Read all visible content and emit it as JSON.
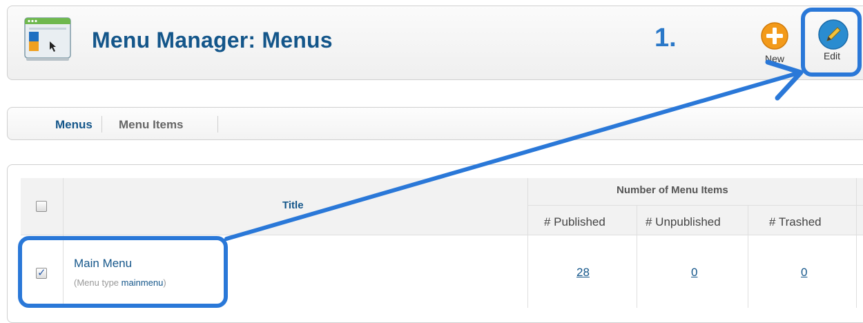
{
  "header": {
    "title": "Menu Manager: Menus",
    "step_label": "1.",
    "icon": "menu-manager-icon"
  },
  "toolbar": {
    "new_label": "New",
    "edit_label": "Edit",
    "new_icon": "plus-circle-icon",
    "edit_icon": "pencil-circle-icon"
  },
  "submenu": {
    "tabs": [
      {
        "label": "Menus",
        "active": true
      },
      {
        "label": "Menu Items",
        "active": false
      }
    ]
  },
  "table": {
    "title_header": "Title",
    "group_header": "Number of Menu Items",
    "sub_headers": [
      "# Published",
      "# Unpublished",
      "# Trashed"
    ],
    "rows": [
      {
        "title": "Main Menu",
        "menu_type_prefix": "(Menu type ",
        "menu_type": "mainmenu",
        "menu_type_suffix": ")",
        "checked": true,
        "published": "28",
        "unpublished": "0",
        "trashed": "0"
      }
    ]
  },
  "colors": {
    "title": "#14568a",
    "highlight": "#2a78d8",
    "new_button": "#f39a1a",
    "edit_button": "#2a8cd0"
  }
}
